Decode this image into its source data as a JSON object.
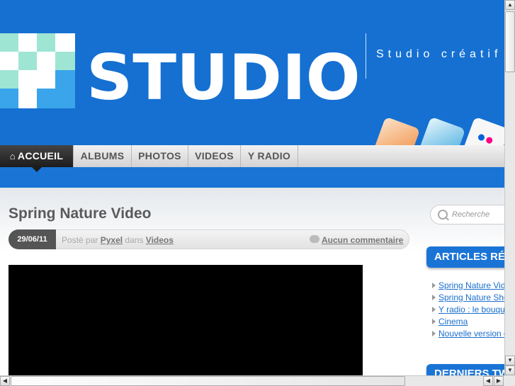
{
  "header": {
    "logo_text": "STUDIO",
    "tagline": "Studio créatif",
    "social_icons": [
      "orange-social-icon",
      "vimeo-icon",
      "flickr-icon"
    ]
  },
  "nav": {
    "items": [
      {
        "label": "ACCUEIL",
        "icon": "home-icon",
        "active": true
      },
      {
        "label": "ALBUMS"
      },
      {
        "label": "PHOTOS"
      },
      {
        "label": "VIDEOS"
      },
      {
        "label": "Y RADIO"
      }
    ]
  },
  "post": {
    "title": "Spring Nature Video",
    "date": "29/06/11",
    "posted_by": "Posté par",
    "author": "Pyxel",
    "in_word": "dans",
    "category": "Videos",
    "comments": "Aucun commentaire",
    "comment_icon": "speech-bubble-icon"
  },
  "sidebar": {
    "search_placeholder": "Recherche",
    "widget1_title": "ARTICLES RÉ",
    "articles": [
      "Spring Nature Vid",
      "Spring Nature Sho",
      "Y radio : le bouqu",
      "Cinema",
      "Nouvelle version d"
    ],
    "widget2_title": "DERNIERS TW"
  },
  "colors": {
    "brand_blue": "#1570d2",
    "logo_cyan": "#9fe5d4",
    "logo_blue": "#3aa5ea",
    "link": "#1a6fce"
  }
}
